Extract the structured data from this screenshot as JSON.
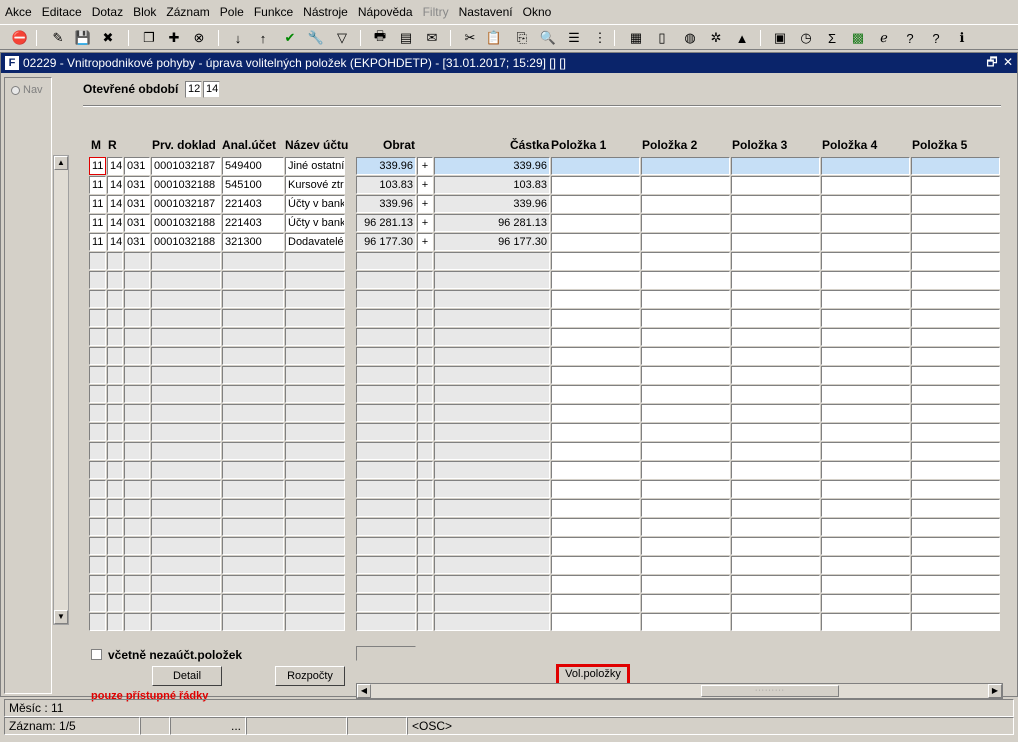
{
  "menu": [
    "Akce",
    "Editace",
    "Dotaz",
    "Blok",
    "Záznam",
    "Pole",
    "Funkce",
    "Nástroje",
    "Nápověda",
    "Filtry",
    "Nastavení",
    "Okno"
  ],
  "menu_disabled_index": 9,
  "toolbar_icons": [
    "exit-icon",
    "edit-icon",
    "save-icon",
    "delete-icon",
    "copy-icon",
    "new-record-icon",
    "delete-record-icon",
    "sort-asc-icon",
    "sort-desc-icon",
    "check-icon",
    "tools-icon",
    "filter-icon",
    "print-icon",
    "print-preview-icon",
    "mail-icon",
    "cut-icon",
    "paste-icon",
    "clone-icon",
    "search-icon",
    "list-icon",
    "tree-icon",
    "calculator-icon",
    "document-icon",
    "globe-icon",
    "settings-icon",
    "chart-icon",
    "report-icon",
    "clock-icon",
    "sum-icon",
    "excel-icon",
    "ie-icon",
    "help-icon",
    "whatis-icon",
    "info-icon"
  ],
  "window": {
    "title": "02229 - Vnitropodnikové pohyby - úprava volitelných položek (EKPOHDETP) - [31.01.2017; 15:29]  [] []",
    "logo": "F",
    "restore": "🗗",
    "close": "✕"
  },
  "nav": {
    "label": "Nav"
  },
  "period": {
    "label": "Otevřené období",
    "month": "12",
    "year": "14"
  },
  "columns": {
    "m": "M",
    "r": "R",
    "doc": "Prv. doklad",
    "acct": "Anal.účet",
    "name": "Název účtu",
    "turnover": "Obrat",
    "amount": "Částka",
    "p1": "Položka 1",
    "p2": "Položka 2",
    "p3": "Položka 3",
    "p4": "Položka 4",
    "p5": "Položka 5"
  },
  "rows": [
    {
      "m": "11",
      "r": "14",
      "t": "031",
      "doc": "0001032187",
      "acct": "549400",
      "name": "Jiné ostatní",
      "turnover": "339.96",
      "sign": "+",
      "amount": "339.96"
    },
    {
      "m": "11",
      "r": "14",
      "t": "031",
      "doc": "0001032188",
      "acct": "545100",
      "name": "Kursové ztr",
      "turnover": "103.83",
      "sign": "+",
      "amount": "103.83"
    },
    {
      "m": "11",
      "r": "14",
      "t": "031",
      "doc": "0001032187",
      "acct": "221403",
      "name": "Účty v bank",
      "turnover": "339.96",
      "sign": "+",
      "amount": "339.96"
    },
    {
      "m": "11",
      "r": "14",
      "t": "031",
      "doc": "0001032188",
      "acct": "221403",
      "name": "Účty v bank",
      "turnover": "96 281.13",
      "sign": "+",
      "amount": "96 281.13"
    },
    {
      "m": "11",
      "r": "14",
      "t": "031",
      "doc": "0001032188",
      "acct": "321300",
      "name": "Dodavatelé",
      "turnover": "96 177.30",
      "sign": "+",
      "amount": "96 177.30"
    }
  ],
  "checkbox": {
    "label": "včetně nezaúčt.položek",
    "checked": false
  },
  "buttons": {
    "detail": "Detail",
    "budget": "Rozpočty",
    "vol": "Vol.položky"
  },
  "note": "pouze přístupné řádky",
  "status": {
    "month": "Měsíc : 11",
    "record": "Záznam: 1/5",
    "dots": "...",
    "osc": "<OSC>"
  },
  "colors": {
    "title_bar": "#0a246a",
    "selected_row": "#c6dff6",
    "highlight": "#e00000"
  }
}
